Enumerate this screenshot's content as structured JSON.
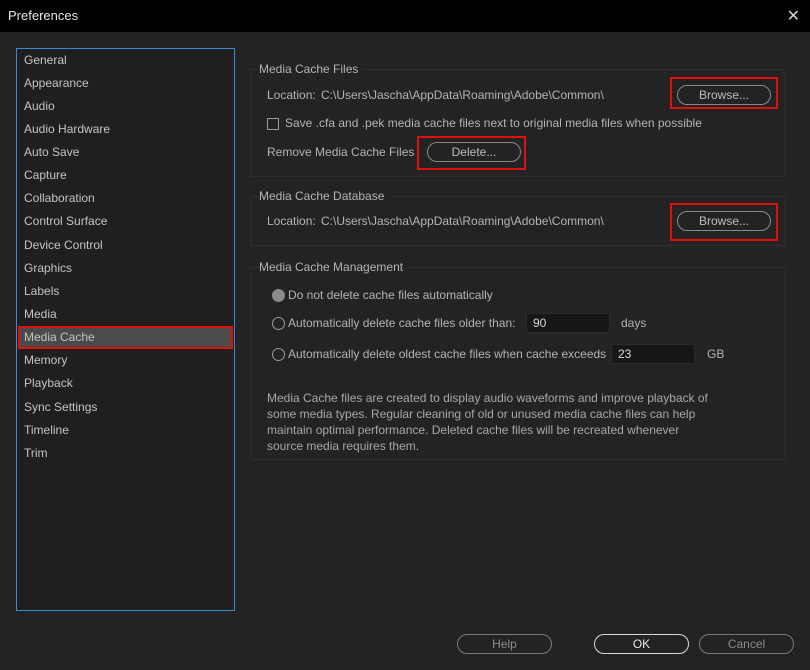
{
  "window": {
    "title": "Preferences",
    "close_glyph": "✕"
  },
  "sidebar": {
    "items": [
      {
        "label": "General"
      },
      {
        "label": "Appearance"
      },
      {
        "label": "Audio"
      },
      {
        "label": "Audio Hardware"
      },
      {
        "label": "Auto Save"
      },
      {
        "label": "Capture"
      },
      {
        "label": "Collaboration"
      },
      {
        "label": "Control Surface"
      },
      {
        "label": "Device Control"
      },
      {
        "label": "Graphics"
      },
      {
        "label": "Labels"
      },
      {
        "label": "Media"
      },
      {
        "label": "Media Cache",
        "selected": true
      },
      {
        "label": "Memory"
      },
      {
        "label": "Playback"
      },
      {
        "label": "Sync Settings"
      },
      {
        "label": "Timeline"
      },
      {
        "label": "Trim"
      }
    ]
  },
  "media_cache_files": {
    "title": "Media Cache Files",
    "location_label": "Location:",
    "location_path": "C:\\Users\\Jascha\\AppData\\Roaming\\Adobe\\Common\\",
    "browse_label": "Browse...",
    "save_checkbox_label": "Save .cfa and .pek media cache files next to original media files when possible",
    "save_checkbox_checked": false,
    "remove_label": "Remove Media Cache Files",
    "delete_label": "Delete..."
  },
  "media_cache_database": {
    "title": "Media Cache Database",
    "location_label": "Location:",
    "location_path": "C:\\Users\\Jascha\\AppData\\Roaming\\Adobe\\Common\\",
    "browse_label": "Browse..."
  },
  "media_cache_management": {
    "title": "Media Cache Management",
    "option_none": "Do not delete cache files automatically",
    "option_older": "Automatically delete cache files older than:",
    "older_value": "90",
    "older_unit": "days",
    "option_exceeds": "Automatically delete oldest cache files when cache exceeds",
    "exceeds_value": "23",
    "exceeds_unit": "GB",
    "selected_option": "none",
    "description": "Media Cache files are created to display audio waveforms and improve playback of some media types.  Regular cleaning of old or unused media cache files can help maintain optimal performance. Deleted cache files will be recreated whenever source media requires them."
  },
  "footer": {
    "help_label": "Help",
    "ok_label": "OK",
    "cancel_label": "Cancel"
  },
  "colors": {
    "highlight": "#e01010",
    "accent_border": "#3a8ad0",
    "selected_bg": "#4a4a4a"
  }
}
